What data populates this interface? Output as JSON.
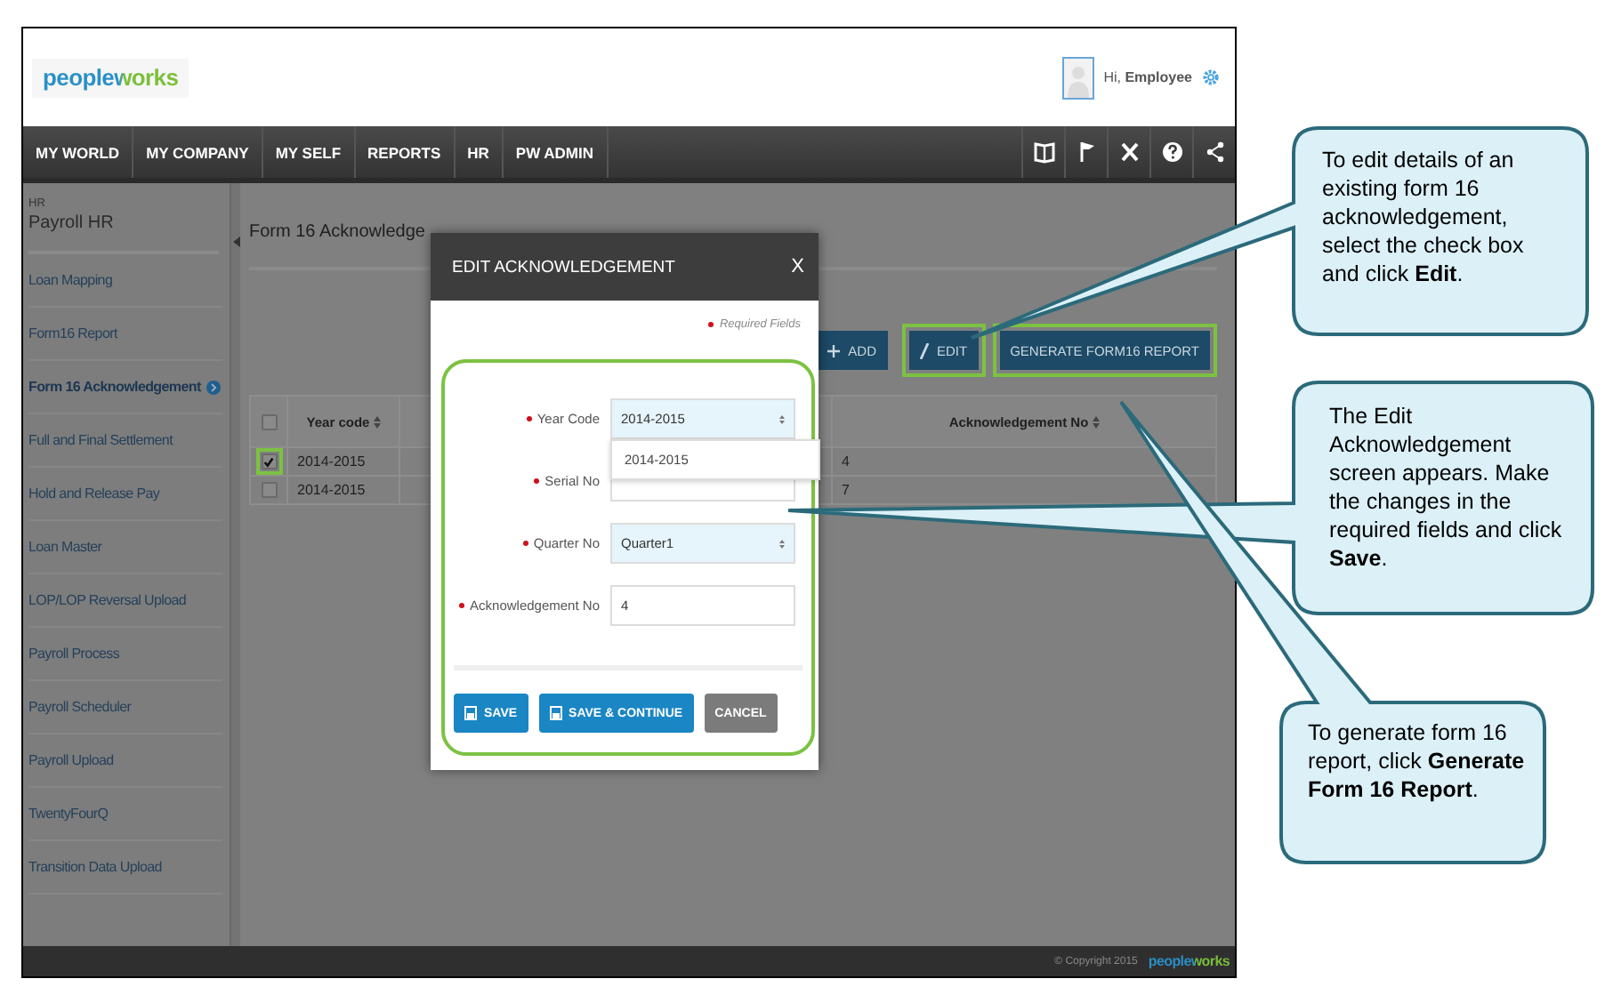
{
  "header": {
    "logo": "peopleworks",
    "greeting": "Hi, **Employee**"
  },
  "nav": {
    "items": [
      "MY WORLD",
      "MY COMPANY",
      "MY SELF",
      "REPORTS",
      "HR",
      "PW ADMIN"
    ]
  },
  "sidebar": {
    "section": "HR",
    "title": "Payroll HR",
    "items": [
      {
        "label": "Loan Mapping",
        "selected": false
      },
      {
        "label": "Form16 Report",
        "selected": false
      },
      {
        "label": "Form 16 Acknowledgement",
        "selected": true
      },
      {
        "label": "Full and Final Settlement",
        "selected": false
      },
      {
        "label": "Hold and Release Pay",
        "selected": false
      },
      {
        "label": "Loan Master",
        "selected": false
      },
      {
        "label": "LOP/LOP Reversal Upload",
        "selected": false
      },
      {
        "label": "Payroll Process",
        "selected": false
      },
      {
        "label": "Payroll Scheduler",
        "selected": false
      },
      {
        "label": "Payroll Upload",
        "selected": false
      },
      {
        "label": "TwentyFourQ",
        "selected": false
      },
      {
        "label": "Transition Data Upload",
        "selected": false
      }
    ]
  },
  "page": {
    "title": "Form 16 Acknowledge"
  },
  "toolbar": [
    {
      "label": "ADD",
      "highlighted": false
    },
    {
      "label": "EDIT",
      "highlighted": true
    },
    {
      "label": "GENERATE FORM16 REPORT",
      "highlighted": true
    }
  ],
  "table": {
    "select_all": {
      "checked": false
    },
    "columns": [
      "Year code",
      "Acknowledgement No"
    ],
    "rows": [
      {
        "checked": true,
        "highlighted": true,
        "year_code": "2014-2015",
        "acknowledgement_no": "4"
      },
      {
        "checked": false,
        "highlighted": false,
        "year_code": "2014-2015",
        "acknowledgement_no": "7"
      }
    ]
  },
  "dialog": {
    "title": "EDIT ACKNOWLEDGEMENT",
    "close": "X",
    "required_note": "Required Fields",
    "highlighted": true,
    "fields": [
      {
        "label": "Year Code",
        "kind": "select",
        "value": "2014-2015",
        "required": true,
        "open_options": [
          "2014-2015"
        ]
      },
      {
        "label": "Serial No",
        "kind": "input",
        "required": true
      },
      {
        "label": "Quarter No",
        "kind": "select",
        "value": "Quarter1",
        "required": true
      },
      {
        "label": "Acknowledgement No",
        "kind": "input",
        "value": "4",
        "required": true
      }
    ],
    "buttons": [
      {
        "label": "SAVE",
        "kind": "primary"
      },
      {
        "label": "SAVE & CONTINUE",
        "kind": "primary"
      },
      {
        "label": "CANCEL",
        "kind": "secondary"
      }
    ]
  },
  "footer": {
    "copyright": "© Copyright 2015",
    "logo": "peopleworks"
  },
  "callouts": [
    {
      "text": "To edit details of an existing form 16 acknowledgement, select the check box and click **Edit**."
    },
    {
      "text": "The Edit Acknowledgement screen appears. Make the changes in the required fields and click **Save**."
    },
    {
      "text": "To generate form 16 report, click **Generate Form 16 Report**."
    }
  ]
}
